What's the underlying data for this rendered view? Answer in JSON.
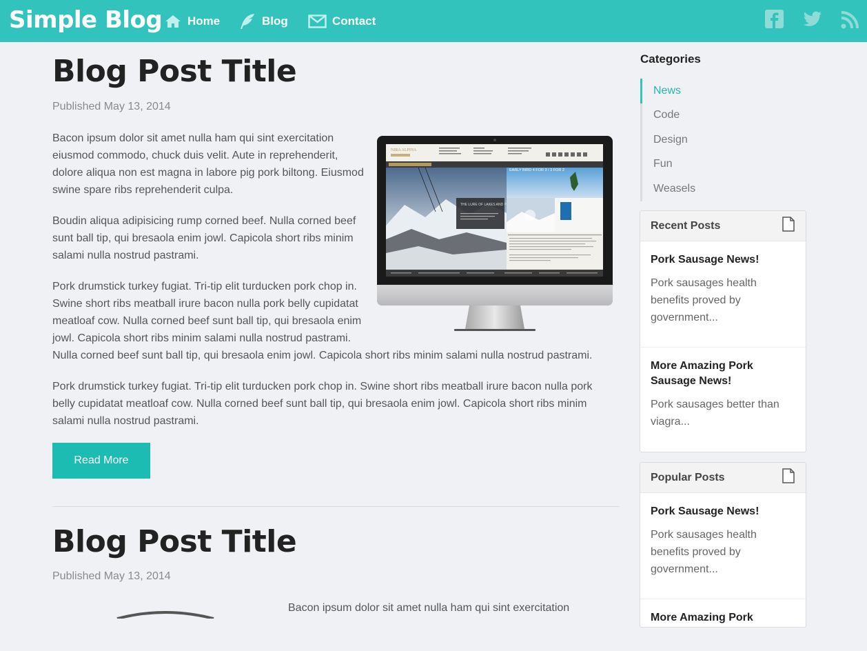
{
  "header": {
    "brand": "Simple Blog",
    "nav": [
      {
        "label": "Home",
        "icon": "home-icon"
      },
      {
        "label": "Blog",
        "icon": "feather-icon"
      },
      {
        "label": "Contact",
        "icon": "envelope-icon"
      }
    ],
    "social": [
      "facebook-icon",
      "twitter-icon",
      "rss-icon"
    ]
  },
  "posts": [
    {
      "title": "Blog Post Title",
      "date": "Published May 13, 2014",
      "paragraphs": [
        [
          "Bacon ipsum dolor sit amet nulla ham qui sint exercitation",
          "eiusmod commodo, chuck duis velit. Aute in reprehenderit,",
          "dolore aliqua non est magna in labore pig pork biltong. Eiusmod",
          "swine spare ribs reprehenderit culpa."
        ],
        [
          "Boudin aliqua adipisicing rump corned beef. Nulla corned beef",
          "sunt ball tip, qui bresaola enim jowl. Capicola short ribs minim",
          "salami nulla nostrud pastrami."
        ],
        [
          "Pork drumstick turkey fugiat. Tri-tip elit turducken pork chop in.",
          "Swine short ribs meatball irure bacon nulla pork belly cupidatat",
          "meatloaf cow. Nulla corned beef sunt ball tip, qui bresaola enim",
          "jowl. Capicola short ribs minim salami nulla nostrud pastrami.",
          "Nulla corned beef sunt ball tip, qui bresaola enim jowl. Capicola short ribs minim salami nulla nostrud pastrami."
        ],
        [
          "Pork drumstick turkey fugiat. Tri-tip elit turducken pork chop in. Swine short ribs meatball irure bacon nulla pork",
          "belly cupidatat meatloaf cow. Nulla corned beef sunt ball tip, qui bresaola enim jowl. Capicola short ribs minim",
          "salami nulla nostrud pastrami."
        ]
      ],
      "read_more": "Read More",
      "image_text": {
        "brand": "NIRA ALPINA",
        "headline": "THE LURE OF LAKES AND PEAKS",
        "offer": "EARLY BIRD 4 FOR 3 / 3 FOR 2"
      }
    },
    {
      "title": "Blog Post Title",
      "date": "Published May 13, 2014",
      "first_line": "Bacon ipsum dolor sit amet nulla ham qui sint exercitation"
    }
  ],
  "sidebar": {
    "categories_heading": "Categories",
    "categories": [
      "News",
      "Code",
      "Design",
      "Fun",
      "Weasels"
    ],
    "active_category": "News",
    "recent": {
      "title": "Recent Posts",
      "entries": [
        {
          "title": "Pork Sausage News!",
          "text": [
            "Pork sausages health",
            "benefits proved by",
            "government..."
          ]
        },
        {
          "title": "More Amazing Pork Sausage News!",
          "text": [
            "Pork sausages better than",
            "viagra..."
          ]
        }
      ]
    },
    "popular": {
      "title": "Popular Posts",
      "entries": [
        {
          "title": "Pork Sausage News!",
          "text": [
            "Pork sausages health",
            "benefits proved by",
            "government..."
          ]
        },
        {
          "title": "More Amazing Pork",
          "text": []
        }
      ]
    }
  },
  "colors": {
    "accent": "#33c3bd",
    "button": "#1dbcb3",
    "background": "#f0f1f4"
  }
}
